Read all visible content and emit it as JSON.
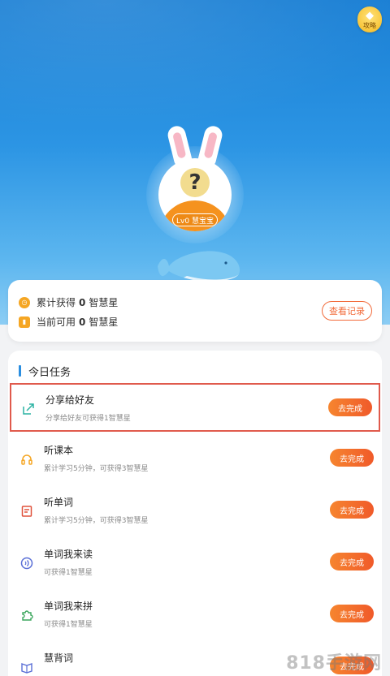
{
  "header": {
    "guide_label": "攻略"
  },
  "profile": {
    "level_badge": "Lv0 慧宝宝"
  },
  "stats": {
    "total": {
      "prefix": "累计获得",
      "value": "0",
      "suffix": "智慧星"
    },
    "available": {
      "prefix": "当前可用",
      "value": "0",
      "suffix": "智慧星"
    },
    "record_button": "查看记录"
  },
  "tasks": {
    "title": "今日任务",
    "items": [
      {
        "name": "分享给好友",
        "desc": "分享给好友可获得1智慧星",
        "button": "去完成",
        "icon": "share-icon",
        "color": "#2bb3a3"
      },
      {
        "name": "听课本",
        "desc": "累计学习5分钟，可获得3智慧星",
        "button": "去完成",
        "icon": "headphones-icon",
        "color": "#f5a623"
      },
      {
        "name": "听单词",
        "desc": "累计学习5分钟，可获得3智慧星",
        "button": "去完成",
        "icon": "note-icon",
        "color": "#e0523c"
      },
      {
        "name": "单词我来读",
        "desc": "可获得1智慧星",
        "button": "去完成",
        "icon": "speaker-icon",
        "color": "#5a6fd6"
      },
      {
        "name": "单词我来拼",
        "desc": "可获得1智慧星",
        "button": "去完成",
        "icon": "puzzle-icon",
        "color": "#3aa55c"
      },
      {
        "name": "慧背词",
        "desc": "",
        "button": "去完成",
        "icon": "book-icon",
        "color": "#5a6fd6"
      }
    ]
  },
  "watermark": "818手游网"
}
